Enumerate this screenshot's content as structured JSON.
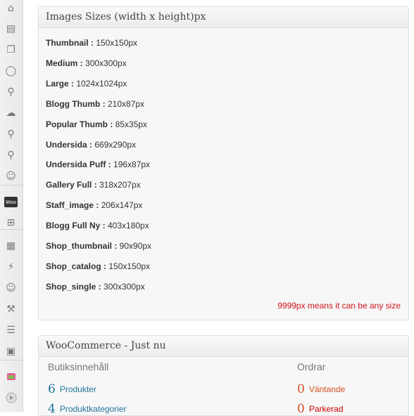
{
  "sizes_box": {
    "title": "Images Sizes (width x height)px",
    "rows": [
      {
        "name": "Thumbnail :",
        "value": "150x150px"
      },
      {
        "name": "Medium :",
        "value": "300x300px"
      },
      {
        "name": "Large :",
        "value": "1024x1024px"
      },
      {
        "name": "Blogg Thumb :",
        "value": "210x87px"
      },
      {
        "name": "Popular Thumb :",
        "value": "85x35px"
      },
      {
        "name": "Undersida :",
        "value": "669x290px"
      },
      {
        "name": "Undersida Puff :",
        "value": "196x87px"
      },
      {
        "name": "Gallery Full :",
        "value": "318x207px"
      },
      {
        "name": "Staff_image :",
        "value": "206x147px"
      },
      {
        "name": "Blogg Full Ny :",
        "value": "403x180px"
      },
      {
        "name": "Shop_thumbnail :",
        "value": "90x90px"
      },
      {
        "name": "Shop_catalog :",
        "value": "150x150px"
      },
      {
        "name": "Shop_single :",
        "value": "300x300px"
      }
    ],
    "note": "9999px means it can be any size"
  },
  "woo_box": {
    "title": "WooCommerce - Just nu",
    "left_heading": "Butiksinnehåll",
    "right_heading": "Ordrar",
    "left_items": [
      {
        "count": "6",
        "label": "Produkter"
      },
      {
        "count": "4",
        "label": "Produktkategorier"
      }
    ],
    "right_items": [
      {
        "count": "0",
        "label": "Väntande"
      },
      {
        "count": "0",
        "label": "Parkerad"
      }
    ]
  },
  "sidebar": {
    "icons": [
      "dashboard-icon",
      "posts-icon",
      "pages-icon",
      "comments-icon",
      "pin-icon",
      "chef-icon",
      "pin-icon",
      "pin-icon",
      "users-icon",
      "woo-icon",
      "cart-icon",
      "appearance-icon",
      "plugins-icon",
      "users-icon",
      "tools-icon",
      "settings-icon",
      "layout-icon",
      "flag-icon",
      "collapse-icon"
    ],
    "woo_badge": "Woo"
  },
  "colors": {
    "link": "#21759b",
    "order_count": "#d54e21",
    "note": "#d0141b"
  }
}
